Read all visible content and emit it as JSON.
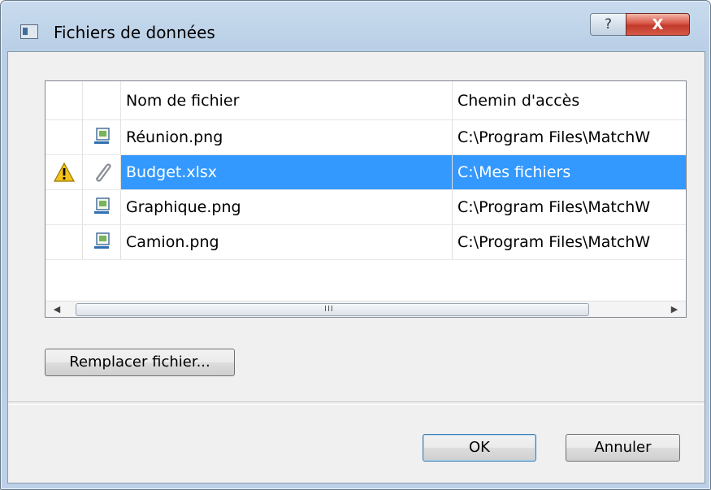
{
  "window": {
    "title": "Fichiers de données",
    "help_glyph": "?",
    "close_glyph": "X"
  },
  "table": {
    "headers": [
      "",
      "",
      "Nom de fichier",
      "Chemin d'accès"
    ],
    "rows": [
      {
        "status_icon": "",
        "file_icon": "image-file-icon",
        "name": "Réunion.png",
        "path": "C:\\Program Files\\MatchW",
        "selected": false
      },
      {
        "status_icon": "warning-icon",
        "file_icon": "paperclip-icon",
        "name": "Budget.xlsx",
        "path": "C:\\Mes fichiers",
        "selected": true
      },
      {
        "status_icon": "",
        "file_icon": "image-file-icon",
        "name": "Graphique.png",
        "path": "C:\\Program Files\\MatchW",
        "selected": false
      },
      {
        "status_icon": "",
        "file_icon": "image-file-icon",
        "name": "Camion.png",
        "path": "C:\\Program Files\\MatchW",
        "selected": false
      }
    ],
    "scroll_left_glyph": "◀",
    "scroll_right_glyph": "▶",
    "thumb_grip": "III"
  },
  "buttons": {
    "replace": "Remplacer fichier...",
    "ok": "OK",
    "cancel": "Annuler"
  },
  "colors": {
    "selection": "#3399ff",
    "warning": "#f2c21a",
    "close": "#c23a2b"
  }
}
